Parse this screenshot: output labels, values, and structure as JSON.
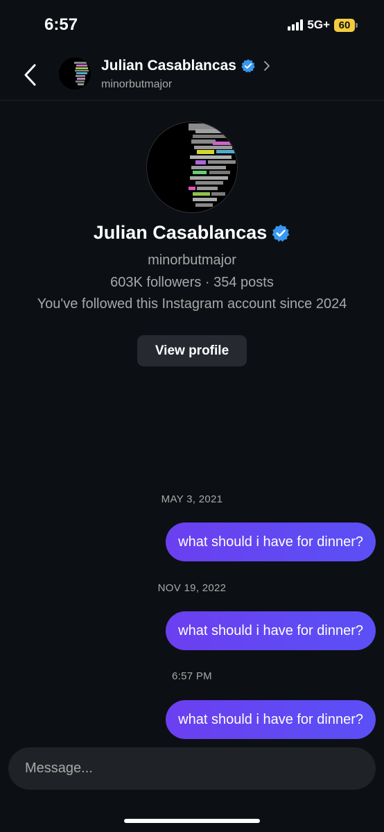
{
  "status_bar": {
    "time": "6:57",
    "network": "5G+",
    "battery": "60"
  },
  "header": {
    "name": "Julian Casablancas",
    "handle": "minorbutmajor"
  },
  "profile": {
    "name": "Julian Casablancas",
    "handle": "minorbutmajor",
    "stats": "603K followers · 354 posts",
    "since": "You've followed this Instagram account since 2024",
    "view_profile_label": "View profile"
  },
  "conversation": [
    {
      "date": "MAY 3, 2021",
      "message": "what should i have for dinner?"
    },
    {
      "date": "NOV 19, 2022",
      "message": "what should i have for dinner?"
    },
    {
      "date": "6:57 PM",
      "message": "what should i have for dinner?"
    }
  ],
  "composer": {
    "placeholder": "Message..."
  },
  "colors": {
    "background": "#0c1014",
    "bubble": "#6142f5",
    "verified": "#3897f0",
    "battery": "#f3cc3e"
  },
  "icons": [
    "back-chevron-icon",
    "verified-badge-icon",
    "chevron-right-icon",
    "signal-bars-icon",
    "battery-icon"
  ]
}
